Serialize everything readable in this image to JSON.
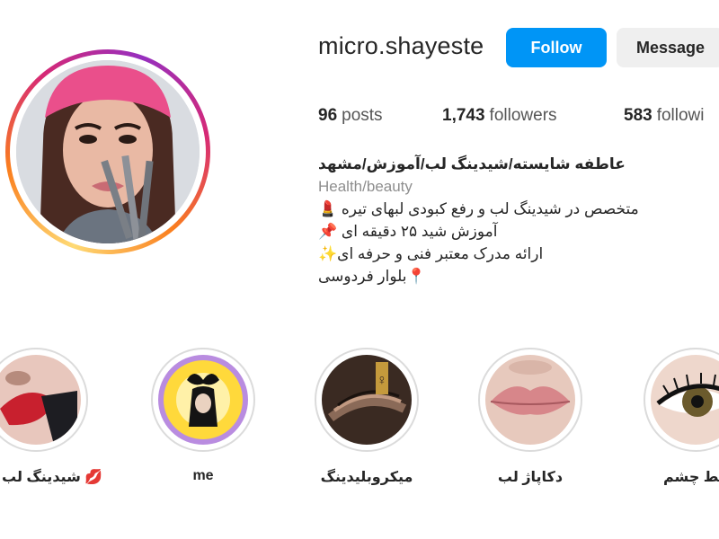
{
  "profile": {
    "username": "micro.shayeste",
    "follow_label": "Follow",
    "message_label": "Message"
  },
  "stats": {
    "posts_count": "96",
    "posts_label": "posts",
    "followers_count": "1,743",
    "followers_label": "followers",
    "following_count": "583",
    "following_label": "followi"
  },
  "bio": {
    "name": "عاطفه شایسته/شیدینگ لب/آموزش/مشهد",
    "category": "Health/beauty",
    "line1": "متخصص در شیدینگ لب و رفع کبودی لبهای تیره 💄",
    "line2": "آموزش شید ۲۵ دقیقه ای 📌",
    "line3": "ارائه مدرک معتبر فنی و حرفه ای✨",
    "line4": "📍بلوار فردوسی"
  },
  "highlights": [
    {
      "label": "شیدینگ لب 💋"
    },
    {
      "label": "me"
    },
    {
      "label": "میکروبلیدینگ"
    },
    {
      "label": "دکاپاژ لب"
    },
    {
      "label": "خط چشم"
    }
  ],
  "colors": {
    "follow_bg": "#0095f6",
    "message_bg": "#efefef",
    "ring_gradient": [
      "#feda75",
      "#fa7e1e",
      "#d62976",
      "#962fbf"
    ],
    "highlight_ring": "#dbdbdb"
  }
}
